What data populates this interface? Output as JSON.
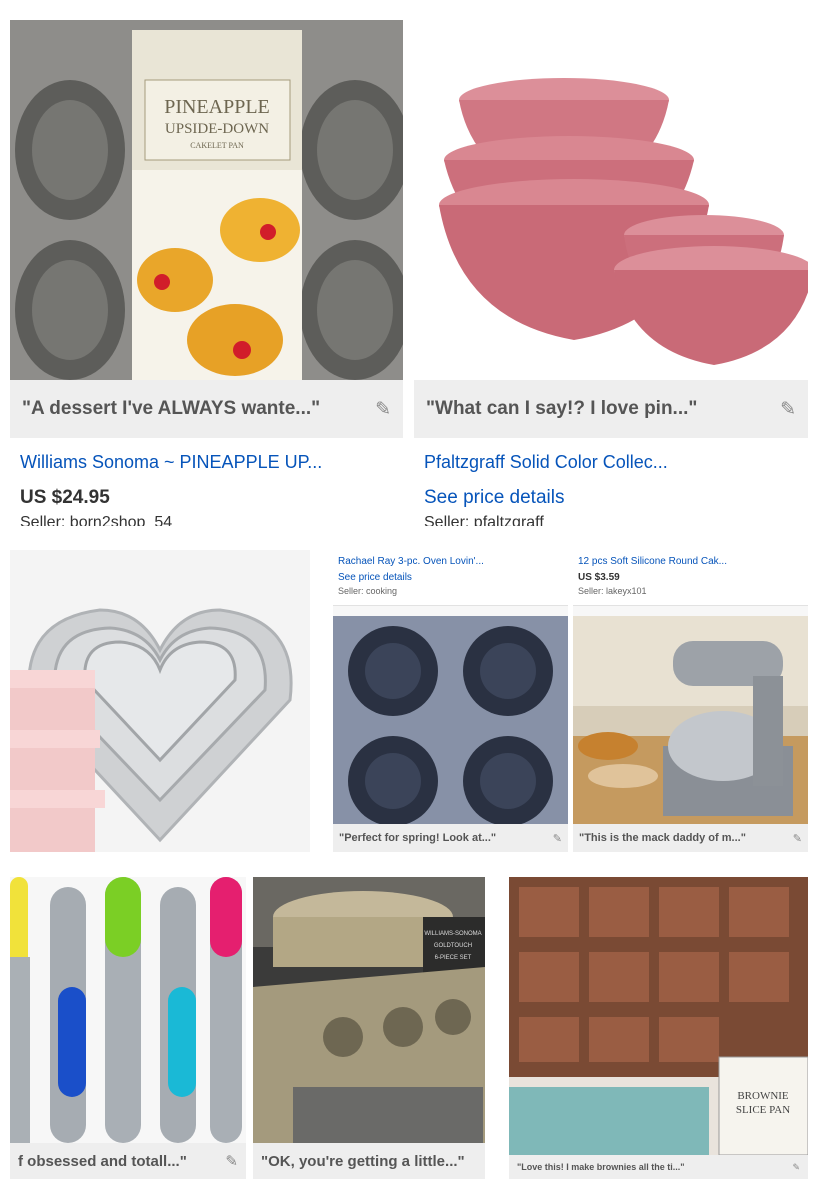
{
  "cards": [
    {
      "caption": "\"A dessert I've ALWAYS wante...\"",
      "title": "Williams Sonoma ~ PINEAPPLE UP...",
      "price": "US $24.95",
      "seller": "Seller: born2shop_54",
      "box_text": [
        "PINEAPPLE",
        "UPSIDE-DOWN",
        "CAKELET PAN"
      ]
    },
    {
      "caption": "\"What can I say!? I love pin...\"",
      "title": "Pfaltzgraff Solid Color Collec...",
      "price_link": "See price details",
      "seller": "Seller: pfaltzgraff"
    },
    {
      "caption": ""
    },
    {
      "title": "Rachael Ray 3-pc. Oven Lovin'...",
      "price_link": "See price details",
      "seller": "Seller: cooking",
      "caption": "\"Perfect for spring! Look at...\""
    },
    {
      "title": "12 pcs Soft Silicone Round Cak...",
      "price": "US $3.59",
      "seller": "Seller: lakeyx101",
      "caption": "\"This is the mack daddy of m...\""
    },
    {
      "caption": "f obsessed and totall...\""
    },
    {
      "caption": "\"OK, you're getting a little...\"",
      "box_text": [
        "WILLIAMS-SONOMA",
        "GOLDTOUCH",
        "6-PIECE SET"
      ]
    },
    {
      "caption": "\"Love this! I make brownies all the ti...\"",
      "box_text": [
        "BROWNIE",
        "SLICE PAN"
      ]
    }
  ],
  "icons": {
    "edit": "pencil-icon"
  },
  "colors": {
    "link": "#0654ba",
    "caption_bg": "#eeeeee"
  }
}
